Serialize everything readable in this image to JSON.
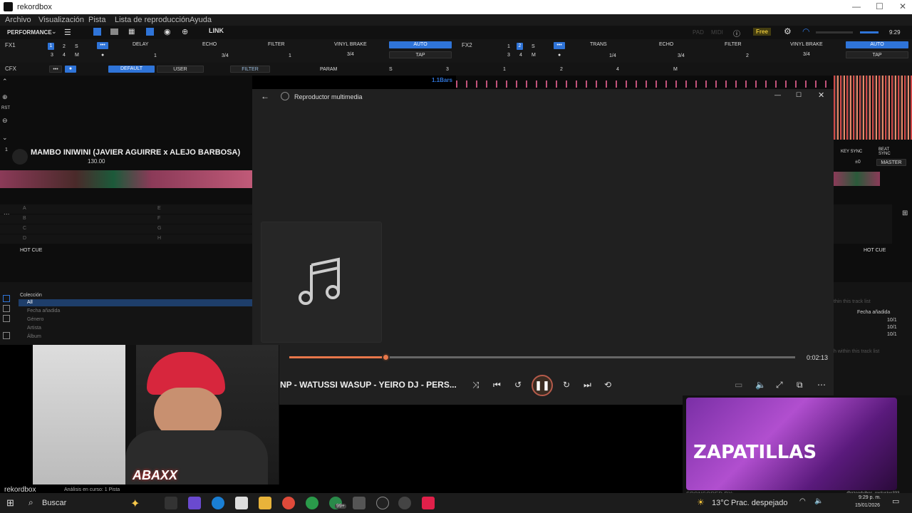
{
  "window": {
    "title": "rekordbox",
    "controls": [
      "—",
      "☐",
      "✕"
    ]
  },
  "menu": [
    "Archivo",
    "Visualización",
    "Pista",
    "Lista de reproducción",
    "Ayuda"
  ],
  "toolbar": {
    "mode": "PERFORMANCE",
    "link": "LINK",
    "pad": "PAD",
    "midi": "MIDI",
    "free": "Free",
    "time": "9:29"
  },
  "fx1": {
    "label": "FX1",
    "slots": [
      "DELAY",
      "ECHO",
      "FILTER"
    ],
    "brake": "VINYL BRAKE",
    "auto": "AUTO",
    "tap": "TAP",
    "beats": [
      "1",
      "3/4",
      "1"
    ],
    "brake_beat": "3/4"
  },
  "fx2": {
    "label": "FX2",
    "slots": [
      "TRANS",
      "ECHO",
      "FILTER"
    ],
    "brake": "VINYL BRAKE",
    "auto": "AUTO",
    "tap": "TAP",
    "beats": [
      "1/4",
      "3/4",
      "2"
    ],
    "brake_beat": "3/4"
  },
  "fx_nums": [
    "1",
    "2",
    "S",
    "3",
    "4",
    "M"
  ],
  "cfx": {
    "label": "CFX",
    "default": "DEFAULT",
    "user": "USER",
    "filter": "FILTER",
    "param": "PARAM",
    "knobs": [
      "S",
      "3",
      "1",
      "2",
      "4",
      "M"
    ]
  },
  "wave": {
    "bars": "1.1Bars"
  },
  "deck1": {
    "number": "1",
    "rst": "RST",
    "title": "MAMBO INIWINI (JAVIER AGUIRRE x ALEJO BARBOSA)",
    "bpm": "130.00",
    "hotcues_left": [
      "A",
      "B",
      "C",
      "D"
    ],
    "hotcues_right": [
      "E",
      "F",
      "G",
      "H"
    ],
    "hotcue_label": "HOT CUE"
  },
  "deck2": {
    "key_sync": "KEY SYNC",
    "beat_sync": "BEAT SYNC",
    "key_val": "±0",
    "master": "MASTER",
    "hotcue_label": "HOT CUE"
  },
  "player": {
    "app": "Reproductor multimedia",
    "elapsed": "0:02:13",
    "progress": 0.19,
    "now_playing": "NP - WATUSSI WASUP - YEIRO DJ - PERS..."
  },
  "browser": {
    "collection": "Colección",
    "items": [
      "All",
      "Fecha añadida",
      "Género",
      "Artista",
      "Álbum"
    ]
  },
  "rbrowser": {
    "search1": "thin this track list",
    "col": "Fecha añadida",
    "values": [
      "10/1",
      "10/1",
      "10/1"
    ],
    "search2": "h within this track list"
  },
  "cam": {
    "logo": "ABAXX"
  },
  "status": {
    "brand": "rekordbox",
    "analysis": "Análisis en curso: 1 Pista"
  },
  "sponsor": {
    "title": "ZAPATILLAS",
    "footer": "SPONSORED BY:",
    "handle": "@gzoodvibes_exclusive333"
  },
  "taskbar": {
    "search": "Buscar",
    "badge": "99+",
    "temp": "13°C",
    "weather": "Prac. despejado",
    "time": "9:29 p. m.",
    "date": "15/01/2026"
  },
  "colors": {
    "accent": "#2f74d8",
    "progress": "#e8774a",
    "free": "#d9c13a"
  }
}
